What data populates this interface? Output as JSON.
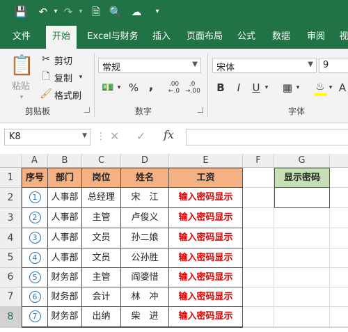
{
  "ribbon": {
    "tabs": [
      "文件",
      "开始",
      "Excel与财务",
      "插入",
      "页面布局",
      "公式",
      "数据",
      "审阅",
      "视"
    ],
    "active_tab": "开始",
    "clipboard": {
      "paste": "粘贴",
      "cut": "剪切",
      "copy": "复制",
      "format_painter": "格式刷",
      "group_label": "剪贴板"
    },
    "number": {
      "format": "常规",
      "percent": "%",
      "comma": ",",
      "group_label": "数字"
    },
    "font": {
      "name": "宋体",
      "size": "9",
      "bold": "B",
      "italic": "I",
      "underline": "U",
      "group_label": "字体"
    }
  },
  "formula_bar": {
    "name_box": "K8",
    "value": ""
  },
  "sheet": {
    "columns": [
      "A",
      "B",
      "C",
      "D",
      "E",
      "F",
      "G"
    ],
    "rows": [
      "1",
      "2",
      "3",
      "4",
      "5",
      "6",
      "7",
      "8"
    ],
    "header": [
      "序号",
      "部门",
      "岗位",
      "姓名",
      "工资"
    ],
    "side_header": "显示密码",
    "records": [
      {
        "no": "1",
        "dept": "人事部",
        "post": "总经理",
        "name": "宋　江",
        "salary": "输入密码显示"
      },
      {
        "no": "2",
        "dept": "人事部",
        "post": "主管",
        "name": "卢俊义",
        "salary": "输入密码显示"
      },
      {
        "no": "3",
        "dept": "人事部",
        "post": "文员",
        "name": "孙二娘",
        "salary": "输入密码显示"
      },
      {
        "no": "4",
        "dept": "人事部",
        "post": "文员",
        "name": "公孙胜",
        "salary": "输入密码显示"
      },
      {
        "no": "5",
        "dept": "财务部",
        "post": "主管",
        "name": "阎婆惜",
        "salary": "输入密码显示"
      },
      {
        "no": "6",
        "dept": "财务部",
        "post": "会计",
        "name": "林　冲",
        "salary": "输入密码显示"
      },
      {
        "no": "7",
        "dept": "财务部",
        "post": "出纳",
        "name": "柴　进",
        "salary": "输入密码显示"
      }
    ]
  },
  "colors": {
    "brand": "#217346",
    "header_fill": "#f4b183",
    "side_header_fill": "#c5e0b4",
    "warning_text": "#e00000",
    "serial_circle": "#2e75b6"
  }
}
